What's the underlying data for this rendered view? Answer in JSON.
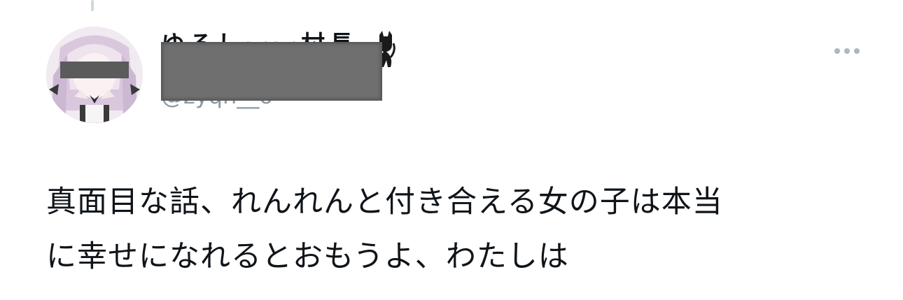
{
  "tweet": {
    "author": {
      "display_name": "ゆるしーー村長",
      "handle": "@zyqn__o",
      "avatar_icon": "anime-girl-avatar-icon",
      "badge_icon": "cat-icon",
      "redaction_color": "#6f6f6f"
    },
    "text_lines": [
      "真面目な話、れんれんと付き合える女の子は本当",
      "に幸せになれるとおもうよ、わたしは"
    ],
    "more_icon": "more-dots-icon"
  }
}
